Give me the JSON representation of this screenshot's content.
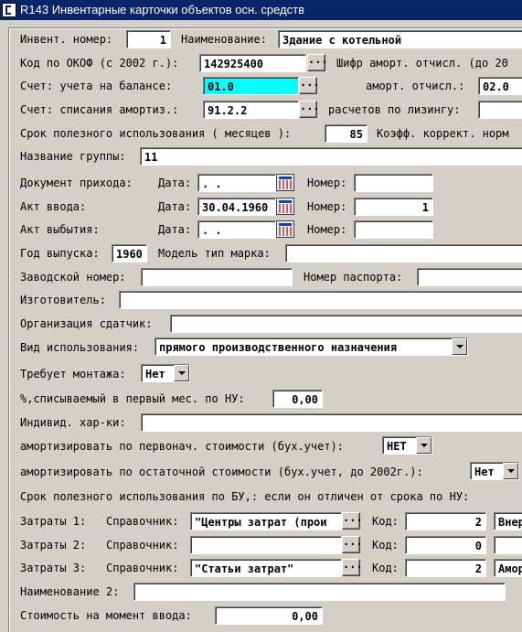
{
  "window": {
    "title": "R143 Инвентарные карточки объектов осн. средств"
  },
  "colors": {
    "titlebar": "#0a246a",
    "highlight_field": "#00ffff",
    "window_bg": "#d4d0c8"
  },
  "icons": {
    "app": "app-icon",
    "lookup": "ellipsis-icon",
    "dropdown": "chevron-down-icon",
    "calendar": "calendar-icon"
  },
  "row1": {
    "inv_label": "Инвент. номер:",
    "inv_value": "1",
    "name_label": "Наименование:",
    "name_value": "Здание с котельной"
  },
  "row2": {
    "okof_label": "Код по ОКОФ (с 2002 г.):",
    "okof_value": "142925400",
    "lookup_btn": "...",
    "shifr_label": "Шифр аморт. отчисл. (до 20"
  },
  "row3": {
    "schet_label": "Счет:  учета на балансе:",
    "schet_value": "01.0",
    "lookup_btn": "...",
    "amort_label": "аморт. отчисл.:",
    "amort_value": "02.0"
  },
  "row4": {
    "schet2_label": "Счет:  списания амортиз.:",
    "schet2_value": "91.2.2",
    "lookup_btn": "...",
    "lease_label": "расчетов по лизингу:"
  },
  "row5": {
    "srok_label": "Срок полезного использования ( месяцев ):",
    "srok_value": "85",
    "koef_label": "Коэфф. коррект. норм"
  },
  "row6": {
    "group_label": "Название группы:",
    "group_value": "11"
  },
  "docs": {
    "date_label": "Дата:",
    "num_label": "Номер:",
    "prihod": {
      "label": "Документ прихода:",
      "date": " .  .",
      "number": ""
    },
    "vvod": {
      "label": "Акт ввода:",
      "date": "30.04.1960",
      "number": "1"
    },
    "vybytie": {
      "label": "Акт выбытия:",
      "date": " .  .",
      "number": ""
    }
  },
  "row_year": {
    "year_label": "Год выпуска:",
    "year_value": "1960",
    "model_label": "Модель тип марка:"
  },
  "row_serial": {
    "serial_label": "Заводской номер:",
    "passport_label": "Номер паспорта:"
  },
  "row_maker": {
    "label": "Изготовитель:"
  },
  "row_org": {
    "label": "Организация сдатчик:"
  },
  "row_use": {
    "label": "Вид использования:",
    "value": "прямого производственного назначения"
  },
  "row_mount": {
    "label": "Требует монтажа:",
    "value": "Нет"
  },
  "row_percent": {
    "label": "%,списываемый в первый мес. по НУ:",
    "value": "0,00"
  },
  "row_indiv": {
    "label": "Индивид. хар-ки:"
  },
  "row_amort1": {
    "label": "амортизировать по первонач. стоимости (бух.учет):",
    "value": "НЕТ"
  },
  "row_amort2": {
    "label": "амортизировать по остаточной стоимости (бух.учет, до 2002г.):",
    "value": "Нет"
  },
  "row_srok_bu": {
    "label": "Срок полезного использования по БУ,:  если он отличен от срока по НУ:"
  },
  "costs": {
    "sprav_label": "Справочник:",
    "kod_label": "Код:",
    "lookup_btn": "...",
    "z1": {
      "label": "Затраты 1:",
      "sprav": "\"Центры затрат (прои",
      "kod": "2",
      "extra": "Внер"
    },
    "z2": {
      "label": "Затраты 2:",
      "sprav": "",
      "kod": "0",
      "extra": ""
    },
    "z3": {
      "label": "Затраты 3:",
      "sprav": "\"Статьи затрат\"",
      "kod": "2",
      "extra": "Амор"
    }
  },
  "row_name2": {
    "label": "Наименование 2:"
  },
  "row_cost": {
    "label": "Стоимость на момент ввода:",
    "value": "0,00"
  }
}
